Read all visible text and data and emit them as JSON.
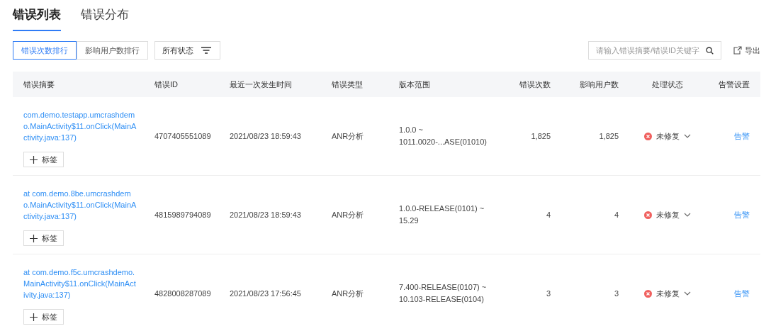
{
  "tabs": [
    {
      "label": "错误列表",
      "selected": true
    },
    {
      "label": "错误分布",
      "selected": false
    }
  ],
  "sort_buttons": [
    {
      "label": "错误次数排行",
      "selected": true
    },
    {
      "label": "影响用户数排行",
      "selected": false
    }
  ],
  "status_filter": {
    "label": "所有状态"
  },
  "search": {
    "placeholder": "请输入错误摘要/错误ID关键字"
  },
  "export": {
    "label": "导出"
  },
  "table": {
    "columns": [
      "错误摘要",
      "错误ID",
      "最近一次发生时间",
      "错误类型",
      "版本范围",
      "错误次数",
      "影响用户数",
      "处理状态",
      "告警设置"
    ],
    "rows": [
      {
        "summary": "com.demo.testapp.umcrashdemo.MainActivity$11.onClick(MainActivity.java:137)",
        "tag_button": "标签",
        "id": "4707405551089",
        "time": "2021/08/23 18:59:43",
        "type": "ANR分析",
        "version": "1.0.0 ~ 1011.0020-...ASE(01010)",
        "count": "1,825",
        "users": "1,825",
        "status": "未修复",
        "alert": "告警"
      },
      {
        "summary": "at com.demo.8be.umcrashdemo.MainActivity$11.onClick(MainActivity.java:137)",
        "tag_button": "标签",
        "id": "4815989794089",
        "time": "2021/08/23 18:59:43",
        "type": "ANR分析",
        "version": "1.0.0-RELEASE(0101) ~ 15.29",
        "count": "4",
        "users": "4",
        "status": "未修复",
        "alert": "告警"
      },
      {
        "summary": "at com.demo.f5c.umcrashdemo.MainActivity$11.onClick(MainActivity.java:137)",
        "tag_button": "标签",
        "id": "4828008287089",
        "time": "2021/08/23 17:56:45",
        "type": "ANR分析",
        "version": "7.400-RELEASE(0107) ~ 10.103-RELEASE(0104)",
        "count": "3",
        "users": "3",
        "status": "未修复",
        "alert": "告警"
      }
    ]
  }
}
